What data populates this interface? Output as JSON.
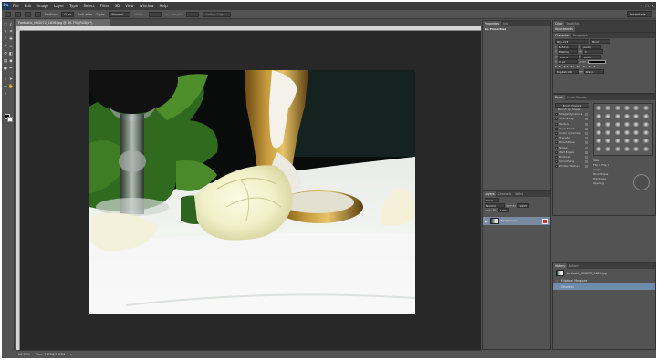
{
  "app": {
    "logo": "Ps",
    "workspace": "Essentials"
  },
  "menus": [
    "File",
    "Edit",
    "Image",
    "Layer",
    "Type",
    "Select",
    "Filter",
    "3D",
    "View",
    "Window",
    "Help"
  ],
  "window_controls": [
    "–",
    "❐",
    "✕"
  ],
  "options_bar": {
    "feather_label": "Feather:",
    "feather_value": "0 px",
    "antialias_label": "Anti-alias",
    "style_label": "Style:",
    "style_value": "Normal",
    "width_label": "Width:",
    "height_label": "Height:",
    "refine_label": "Refine Edge..."
  },
  "document": {
    "tab_title": "Fantastic_IMG072_1826.jpg @ 66.7% (RGB/8*)"
  },
  "status": {
    "zoom": "66.67%",
    "doc": "Doc: 7.63M/7.63M"
  },
  "tools": [
    "marquee-icon",
    "lasso-icon",
    "quick-select-icon",
    "crop-icon",
    "eyedropper-icon",
    "healing-icon",
    "brush-icon",
    "stamp-icon",
    "history-brush-icon",
    "eraser-icon",
    "gradient-icon",
    "blur-icon",
    "dodge-icon",
    "pen-icon",
    "type-icon",
    "path-select-icon",
    "shape-icon",
    "hand-icon",
    "zoom-icon"
  ],
  "properties": {
    "tabs": [
      "Properties",
      "Info"
    ],
    "body": "No Properties"
  },
  "color_panel": {
    "tabs": [
      "Color",
      "Swatches"
    ],
    "adjust_tabs": [
      "Adjustments"
    ]
  },
  "character": {
    "tabs": [
      "Character",
      "Paragraph"
    ],
    "font": "Liliy 27E",
    "style": "Bold",
    "size": "6.52 pt",
    "leading": "(Auto)",
    "tracking_label": "Metrics",
    "tracking": "0",
    "vscale": "100%",
    "hscale": "100%",
    "baseline": "0 pt",
    "color_label": "Color:",
    "language": "English: UK",
    "aa": "Sharp",
    "styles": [
      "T",
      "T",
      "TT",
      "Tr",
      "T¹",
      "T₁",
      "T",
      "Ŧ"
    ]
  },
  "brush": {
    "tabs": [
      "Brush",
      "Brush Presets"
    ],
    "presets_button": "Brush Presets",
    "tip_label": "Brush Tip Shape",
    "options": [
      "Shape Dynamics",
      "Scattering",
      "Texture",
      "Dual Brush",
      "Color Dynamics",
      "Transfer",
      "Brush Pose",
      "Noise",
      "Wet Edges",
      "Build-up",
      "Smoothing",
      "Protect Texture"
    ],
    "size_label": "Size",
    "flip_x": "Flip X",
    "flip_y": "Flip Y",
    "angle_label": "Angle",
    "roundness_label": "Roundness",
    "hardness_label": "Hardness",
    "spacing_label": "Spacing"
  },
  "layers": {
    "tabs": [
      "Layers",
      "Channels",
      "Paths"
    ],
    "kind": "Kind",
    "blend": "Normal",
    "opacity_label": "Opacity:",
    "opacity": "100%",
    "lock_label": "Lock:",
    "fill_label": "Fill:",
    "fill": "100%",
    "layer_name": "Background"
  },
  "history": {
    "tabs": [
      "History",
      "Actions"
    ],
    "snapshot": "Fantastic_IMG072_1826.jpg",
    "items": [
      "Elliptical Marquee",
      "Deselect"
    ]
  }
}
